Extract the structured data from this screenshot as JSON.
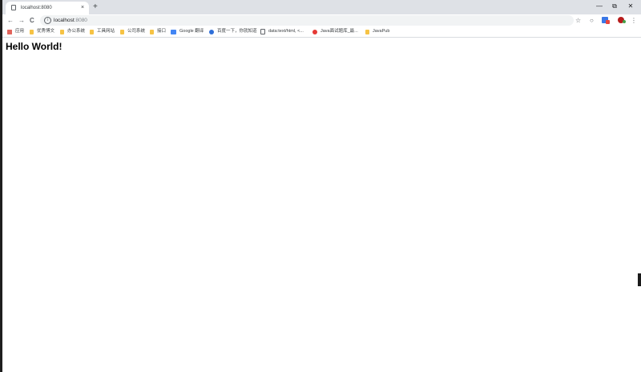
{
  "tab": {
    "title": "localhost:8080",
    "close_glyph": "×",
    "new_tab_glyph": "+"
  },
  "window_controls": {
    "minimize": "—",
    "restore": "⧉",
    "close": "✕"
  },
  "toolbar": {
    "back_glyph": "←",
    "forward_glyph": "→",
    "reload_glyph": "C",
    "info_glyph": "i",
    "url_host": "localhost",
    "url_port": ":8080",
    "star_glyph": "☆",
    "circle_glyph": "○",
    "menu_glyph": "⋮"
  },
  "bookmarks": [
    {
      "label": "应用",
      "icon": "apps-icon"
    },
    {
      "label": "优秀博文",
      "icon": "folder-icon"
    },
    {
      "label": "办公系统",
      "icon": "folder-icon"
    },
    {
      "label": "工具网站",
      "icon": "folder-icon"
    },
    {
      "label": "公司系统",
      "icon": "folder-icon"
    },
    {
      "label": "接口",
      "icon": "folder-icon"
    },
    {
      "label": "Google 翻译",
      "icon": "google-translate-icon"
    },
    {
      "label": "百度一下，你就知道",
      "icon": "baidu-icon"
    },
    {
      "label": "data:text/html, <...",
      "icon": "page-icon"
    },
    {
      "label": "Java面试题库_最...",
      "icon": "java-icon"
    },
    {
      "label": "JavaPub",
      "icon": "folder-icon"
    }
  ],
  "page": {
    "heading": "Hello World!"
  },
  "colors": {
    "tabstrip": "#dee1e6",
    "omnibox": "#f1f3f4",
    "folder": "#f6c344"
  }
}
